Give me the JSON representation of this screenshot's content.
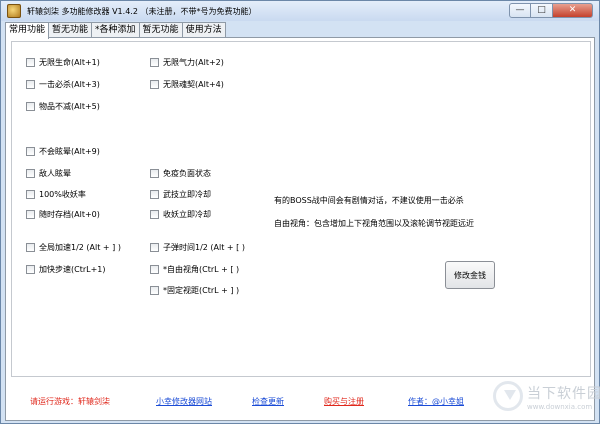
{
  "window": {
    "title": "轩辕剑柒 多功能修改器 V1.4.2 （未注册，不带*号为免费功能）",
    "controls": {
      "minimize": "—",
      "maximize": "□",
      "close": "✕"
    }
  },
  "tabs": [
    {
      "label": "常用功能",
      "active": true
    },
    {
      "label": "暂无功能",
      "active": false
    },
    {
      "label": "*各种添加",
      "active": false
    },
    {
      "label": "暂无功能",
      "active": false
    },
    {
      "label": "使用方法",
      "active": false
    }
  ],
  "options": [
    {
      "label": "无限生命(Alt+1)",
      "checked": false
    },
    {
      "label": "无限气力(Alt+2)",
      "checked": false
    },
    {
      "label": "一击必杀(Alt+3)",
      "checked": false
    },
    {
      "label": "无限魂契(Alt+4)",
      "checked": false
    },
    {
      "label": "物品不减(Alt+5)",
      "checked": false
    },
    {
      "label": "不会眩晕(Alt+9)",
      "checked": false
    },
    {
      "label": "敌人眩晕",
      "checked": false
    },
    {
      "label": "免疫负面状态",
      "checked": false
    },
    {
      "label": "100%收妖率",
      "checked": false
    },
    {
      "label": "武技立即冷却",
      "checked": false
    },
    {
      "label": "随时存档(Alt+0)",
      "checked": false
    },
    {
      "label": "收妖立即冷却",
      "checked": false
    },
    {
      "label": "全局加速1/2 (Alt + ] )",
      "checked": false
    },
    {
      "label": "子弹时间1/2 (Alt + [ )",
      "checked": false
    },
    {
      "label": "加快步速(CtrL+1)",
      "checked": false
    },
    {
      "label": "*自由视角(CtrL + [ )",
      "checked": false
    },
    {
      "label": "*固定视距(CtrL + ] )",
      "checked": false
    }
  ],
  "notes": {
    "boss": "有的BOSS战中间会有剧情对话，不建议使用一击必杀",
    "camera": "自由视角：包含增加上下视角范围以及滚轮调节视距远近"
  },
  "buttons": {
    "modify_money": "修改金钱"
  },
  "footer": {
    "game_prompt": "请运行游戏：轩辕剑柒",
    "site_link": "小幸修改器网站",
    "update_link": "检查更新",
    "register_link": "购买与注册",
    "author_link": "作者：@小幸姐"
  },
  "watermark": {
    "text": "当下软件园",
    "url": "www.downxia.com"
  },
  "icons": {
    "app": "app-icon",
    "checkbox": "checkbox-icon"
  }
}
